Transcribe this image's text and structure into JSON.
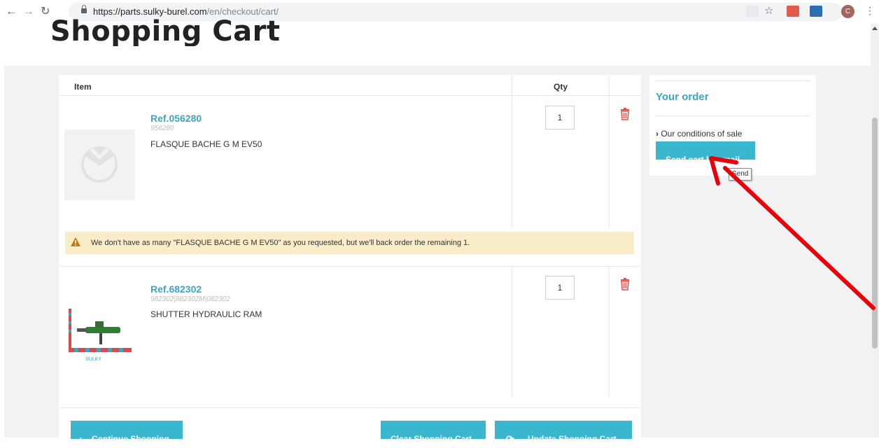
{
  "browser": {
    "url_host": "https://parts.sulky-burel.com",
    "url_path": "/en/checkout/cart/",
    "profile_initial": "C"
  },
  "page": {
    "title": "Shopping Cart"
  },
  "cart": {
    "headers": {
      "item": "Item",
      "qty": "Qty"
    },
    "items": [
      {
        "ref": "Ref.056280",
        "sku": "956280",
        "name": "FLASQUE BACHE G M EV50",
        "qty": "1"
      },
      {
        "ref": "Ref.682302",
        "sku": "982302|982302M|082302",
        "name": "SHUTTER HYDRAULIC RAM",
        "qty": "1"
      }
    ],
    "warning": "We don't have as many \"FLASQUE BACHE G M EV50\" as you requested, but we'll back order the remaining 1.",
    "buttons": {
      "continue": "Continue Shopping",
      "clear": "Clear Shopping Cart",
      "update": "Update Shopping Cart"
    }
  },
  "sidebar": {
    "title": "Your order",
    "conditions_link": "Our conditions of sale",
    "send_button": "Send cart by email",
    "tooltip": "Send"
  },
  "product_image_text": "SULKY",
  "colors": {
    "accent": "#3ab7cf",
    "link": "#3aa6c4",
    "warning_bg": "#fbecc9",
    "delete": "#d9534f",
    "annotation_arrow": "#e8000b"
  }
}
